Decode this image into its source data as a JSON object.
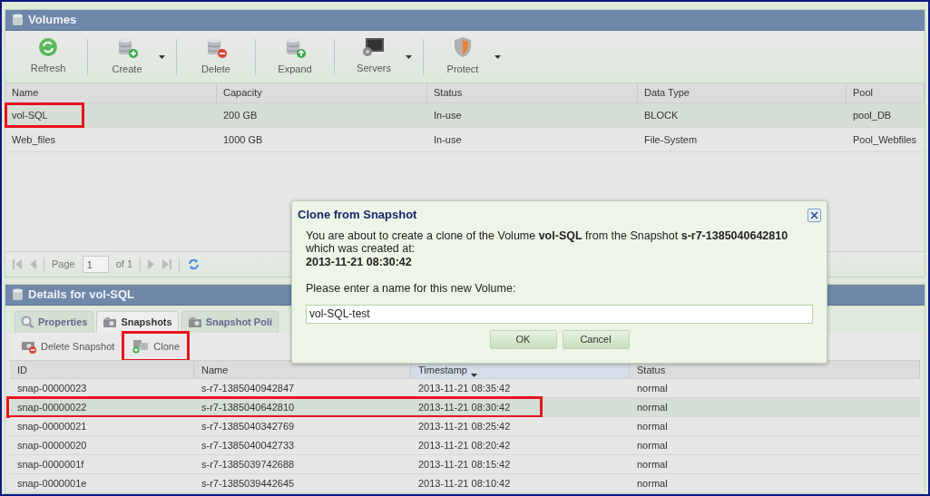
{
  "volumes": {
    "title": "Volumes",
    "toolbar": [
      {
        "label": "Refresh",
        "kind": "refresh",
        "dropdown": false
      },
      {
        "label": "Create",
        "kind": "create",
        "dropdown": true
      },
      {
        "label": "Delete",
        "kind": "delete",
        "dropdown": false
      },
      {
        "label": "Expand",
        "kind": "expand",
        "dropdown": false
      },
      {
        "label": "Servers",
        "kind": "servers",
        "dropdown": true
      },
      {
        "label": "Protect",
        "kind": "protect",
        "dropdown": true
      }
    ],
    "columns": [
      "Name",
      "Capacity",
      "Status",
      "Data Type",
      "Pool"
    ],
    "rows": [
      {
        "cells": [
          "vol-SQL",
          "200 GB",
          "In-use",
          "BLOCK",
          "pool_DB"
        ],
        "selected": true,
        "highlighted": true
      },
      {
        "cells": [
          "Web_files",
          "1000 GB",
          "In-use",
          "File-System",
          "Pool_Webfiles"
        ],
        "selected": false,
        "highlighted": false
      }
    ],
    "pager": {
      "page_label": "Page",
      "page": "1",
      "of": "of 1"
    }
  },
  "details": {
    "title": "Details for vol-SQL",
    "tabs": [
      {
        "label": "Properties",
        "kind": "properties",
        "selected": false
      },
      {
        "label": "Snapshots",
        "kind": "camera",
        "selected": true
      },
      {
        "label": "Snapshot Poli",
        "kind": "camera",
        "selected": false
      }
    ],
    "toolbar": [
      {
        "label": "Delete Snapshot",
        "kind": "delete",
        "highlighted": false
      },
      {
        "label": "Clone",
        "kind": "clone",
        "highlighted": true
      }
    ],
    "columns": [
      "ID",
      "Name",
      "Timestamp",
      "Status"
    ],
    "rows": [
      {
        "cells": [
          "snap-00000023",
          "s-r7-1385040942847",
          "2013-11-21 08:35:42",
          "normal"
        ],
        "selected": false,
        "highlighted": false
      },
      {
        "cells": [
          "snap-00000022",
          "s-r7-1385040642810",
          "2013-11-21 08:30:42",
          "normal"
        ],
        "selected": true,
        "highlighted": true
      },
      {
        "cells": [
          "snap-00000021",
          "s-r7-1385040342769",
          "2013-11-21 08:25:42",
          "normal"
        ],
        "selected": false,
        "highlighted": false
      },
      {
        "cells": [
          "snap-00000020",
          "s-r7-1385040042733",
          "2013-11-21 08:20:42",
          "normal"
        ],
        "selected": false,
        "highlighted": false
      },
      {
        "cells": [
          "snap-0000001f",
          "s-r7-1385039742688",
          "2013-11-21 08:15:42",
          "normal"
        ],
        "selected": false,
        "highlighted": false
      },
      {
        "cells": [
          "snap-0000001e",
          "s-r7-1385039442645",
          "2013-11-21 08:10:42",
          "normal"
        ],
        "selected": false,
        "highlighted": false
      }
    ]
  },
  "dialog": {
    "title": "Clone from Snapshot",
    "message": "You are about to create a clone of the Volume **vol-SQL** from the Snapshot **s-r7-1385040642810** which was created at:",
    "created_at": "2013-11-21 08:30:42",
    "prompt": "Please enter a name for this new Volume:",
    "value": "vol-SQL-test",
    "buttons": [
      "OK",
      "Cancel"
    ]
  }
}
